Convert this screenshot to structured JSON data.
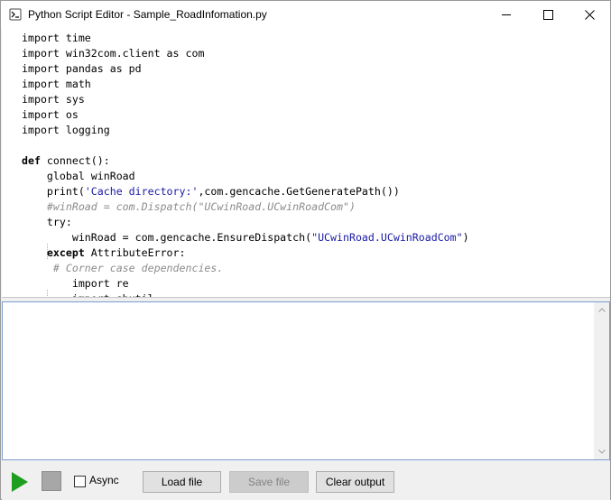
{
  "window": {
    "title": "Python Script Editor - Sample_RoadInfomation.py"
  },
  "editor": {
    "lines": [
      [
        {
          "t": "import time",
          "c": ""
        }
      ],
      [
        {
          "t": "import win32com.client as com",
          "c": ""
        }
      ],
      [
        {
          "t": "import pandas as pd",
          "c": ""
        }
      ],
      [
        {
          "t": "import math",
          "c": ""
        }
      ],
      [
        {
          "t": "import sys",
          "c": ""
        }
      ],
      [
        {
          "t": "import os",
          "c": ""
        }
      ],
      [
        {
          "t": "import logging",
          "c": ""
        }
      ],
      [
        {
          "t": "",
          "c": ""
        }
      ],
      [
        {
          "t": "def",
          "c": "kw"
        },
        {
          "t": " connect():",
          "c": ""
        }
      ],
      [
        {
          "t": "    global winRoad",
          "c": ""
        }
      ],
      [
        {
          "t": "    print(",
          "c": ""
        },
        {
          "t": "'Cache directory:'",
          "c": "str"
        },
        {
          "t": ",com.gencache.GetGeneratePath())",
          "c": ""
        }
      ],
      [
        {
          "t": "    ",
          "c": ""
        },
        {
          "t": "#winRoad = com.Dispatch(\"UCwinRoad.UCwinRoadCom\")",
          "c": "cmt"
        }
      ],
      [
        {
          "t": "    try:",
          "c": ""
        }
      ],
      [
        {
          "t": "        winRoad = com.gencache.EnsureDispatch(",
          "c": ""
        },
        {
          "t": "\"UCwinRoad.UCwinRoadCom\"",
          "c": "str"
        },
        {
          "t": ")",
          "c": ""
        }
      ],
      [
        {
          "t": "    ",
          "c": ""
        },
        {
          "t": "except",
          "c": "kw"
        },
        {
          "t": " AttributeError:",
          "c": ""
        }
      ],
      [
        {
          "t": "     ",
          "c": ""
        },
        {
          "t": "# Corner case dependencies.",
          "c": "cmt"
        }
      ],
      [
        {
          "t": "        import re",
          "c": ""
        }
      ],
      [
        {
          "t": "        import shutil",
          "c": ""
        }
      ]
    ]
  },
  "output": {
    "text": ""
  },
  "toolbar": {
    "async_label": "Async",
    "async_checked": false,
    "load_label": "Load file",
    "save_label": "Save file",
    "clear_label": "Clear output"
  },
  "icons": {
    "app": "python-script-icon",
    "minimize": "minimize-icon",
    "maximize": "maximize-icon",
    "close": "close-icon",
    "run": "play-icon",
    "stop": "stop-icon"
  },
  "colors": {
    "run_green": "#1e9e1e",
    "string_blue": "#1a1aa6",
    "comment_gray": "#8c8c8c",
    "output_border": "#7a9ccc"
  }
}
